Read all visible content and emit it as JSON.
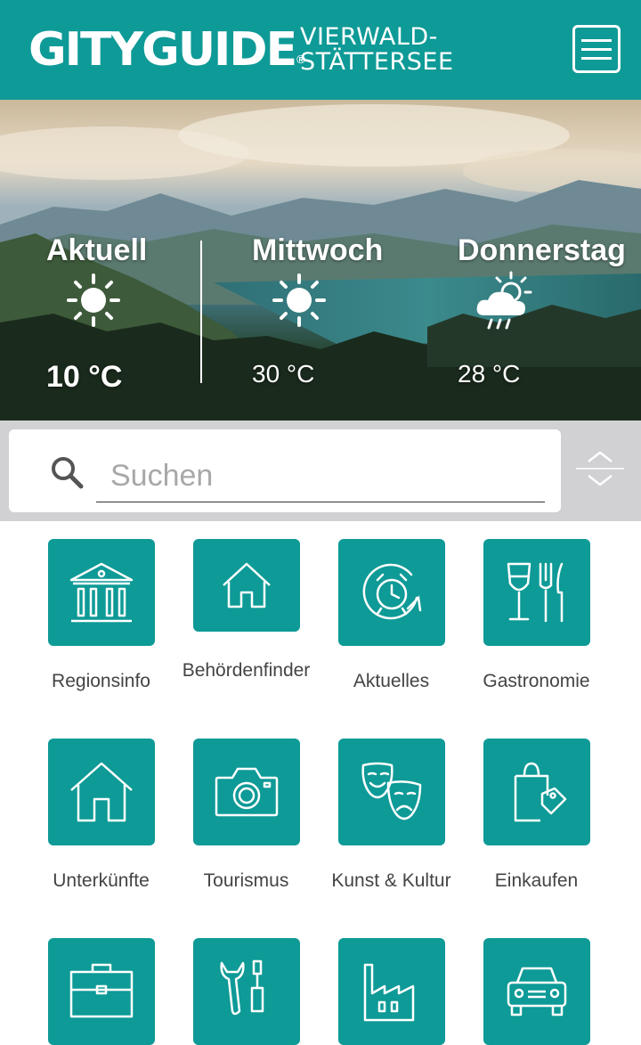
{
  "header": {
    "logo_main": "GITYGUIDE",
    "logo_reg": "®",
    "logo_sub_line1": "VIERWALD-",
    "logo_sub_line2": "STÄTTERSEE",
    "brand_color": "#0e9a97",
    "menu_icon": "hamburger-menu-icon"
  },
  "weather": [
    {
      "day": "Aktuell",
      "temp": "10 °C",
      "icon": "sun-icon"
    },
    {
      "day": "Mittwoch",
      "temp": "30 °C",
      "icon": "sun-icon"
    },
    {
      "day": "Donnerstag",
      "temp": "28 °C",
      "icon": "cloud-sun-rain-icon"
    }
  ],
  "search": {
    "placeholder": "Suchen",
    "value": "",
    "icon": "search-icon",
    "toggle_icon": "chevron-up-down-icon"
  },
  "categories": [
    {
      "label": "Regionsinfo",
      "icon": "building-columns-icon"
    },
    {
      "label": "Behördenfinder",
      "icon": "house-icon"
    },
    {
      "label": "Aktuelles",
      "icon": "alarm-clock-icon"
    },
    {
      "label": "Gastronomie",
      "icon": "wine-glass-fork-knife-icon"
    },
    {
      "label": "Unterkünfte",
      "icon": "home-icon"
    },
    {
      "label": "Tourismus",
      "icon": "camera-icon"
    },
    {
      "label": "Kunst & Kultur",
      "icon": "theater-masks-icon"
    },
    {
      "label": "Einkaufen",
      "icon": "shopping-bag-icon"
    },
    {
      "label": "",
      "icon": "briefcase-icon"
    },
    {
      "label": "",
      "icon": "wrench-screwdriver-icon"
    },
    {
      "label": "",
      "icon": "factory-icon"
    },
    {
      "label": "",
      "icon": "car-icon"
    }
  ]
}
